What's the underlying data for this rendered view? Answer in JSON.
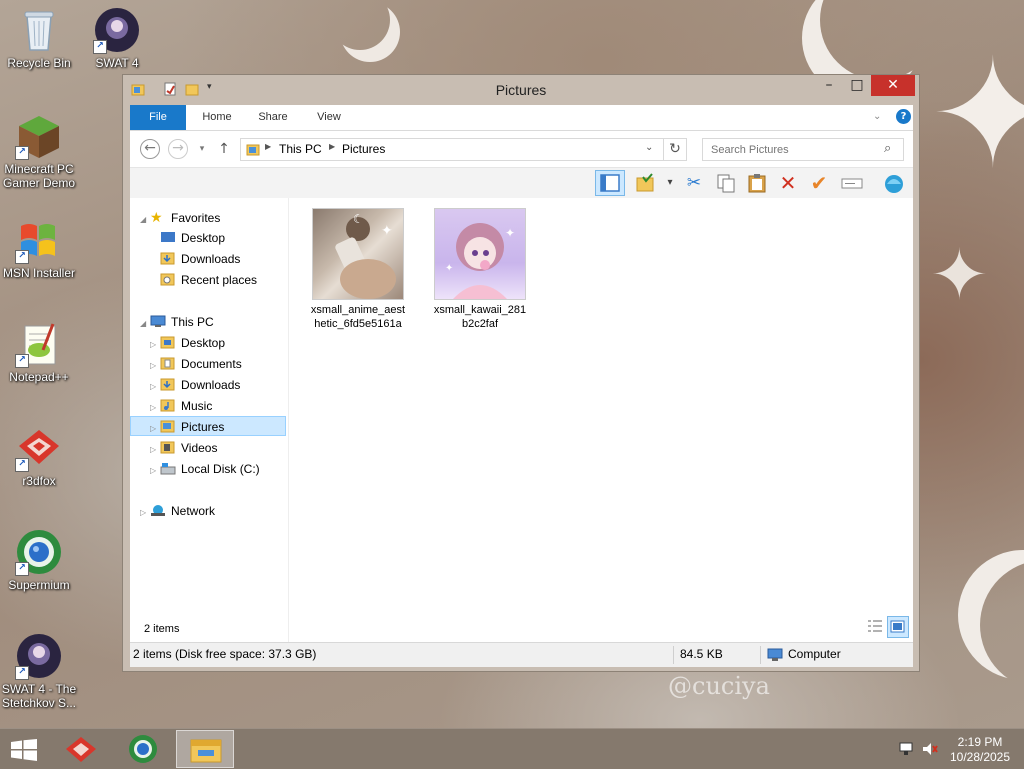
{
  "desktop": {
    "icons": [
      {
        "label": "Recycle Bin"
      },
      {
        "label": "SWAT 4"
      },
      {
        "label": "Minecraft PC Gamer Demo"
      },
      {
        "label": "MSN Installer"
      },
      {
        "label": "Notepad++"
      },
      {
        "label": "r3dfox"
      },
      {
        "label": "Supermium"
      },
      {
        "label": "SWAT 4 - The Stetchkov S..."
      }
    ]
  },
  "window": {
    "title": "Pictures",
    "controls": {
      "minimize": "–",
      "maximize": "□",
      "close": "✕"
    },
    "ribbon_tabs": [
      "File",
      "Home",
      "Share",
      "View"
    ],
    "address": {
      "segments": [
        "This PC",
        "Pictures"
      ]
    },
    "search": {
      "placeholder": "Search Pictures"
    },
    "toolbar": {
      "icons": [
        "preview-pane-icon",
        "folder-options-icon",
        "cut-icon",
        "copy-icon",
        "paste-icon",
        "delete-icon",
        "check-icon",
        "rename-icon",
        "properties-icon"
      ]
    },
    "nav": {
      "favorites": {
        "label": "Favorites",
        "items": [
          "Desktop",
          "Downloads",
          "Recent places"
        ]
      },
      "this_pc": {
        "label": "This PC",
        "items": [
          "Desktop",
          "Documents",
          "Downloads",
          "Music",
          "Pictures",
          "Videos",
          "Local Disk (C:)"
        ]
      },
      "network": {
        "label": "Network"
      },
      "selected": "Pictures"
    },
    "files": [
      {
        "name": "xsmall_anime_aesthetic_6fd5e5161a"
      },
      {
        "name": "xsmall_kawaii_281b2c2faf"
      }
    ],
    "item_count": "2 items",
    "status": {
      "items_disk": "2 items (Disk free space: 37.3 GB)",
      "size": "84.5 KB",
      "location": "Computer"
    }
  },
  "taskbar": {
    "time": "2:19 PM",
    "date": "10/28/2025",
    "apps": [
      "r3dfox",
      "Supermium",
      "File Explorer"
    ]
  },
  "wallpaper": {
    "watermark": "@cuciya"
  }
}
